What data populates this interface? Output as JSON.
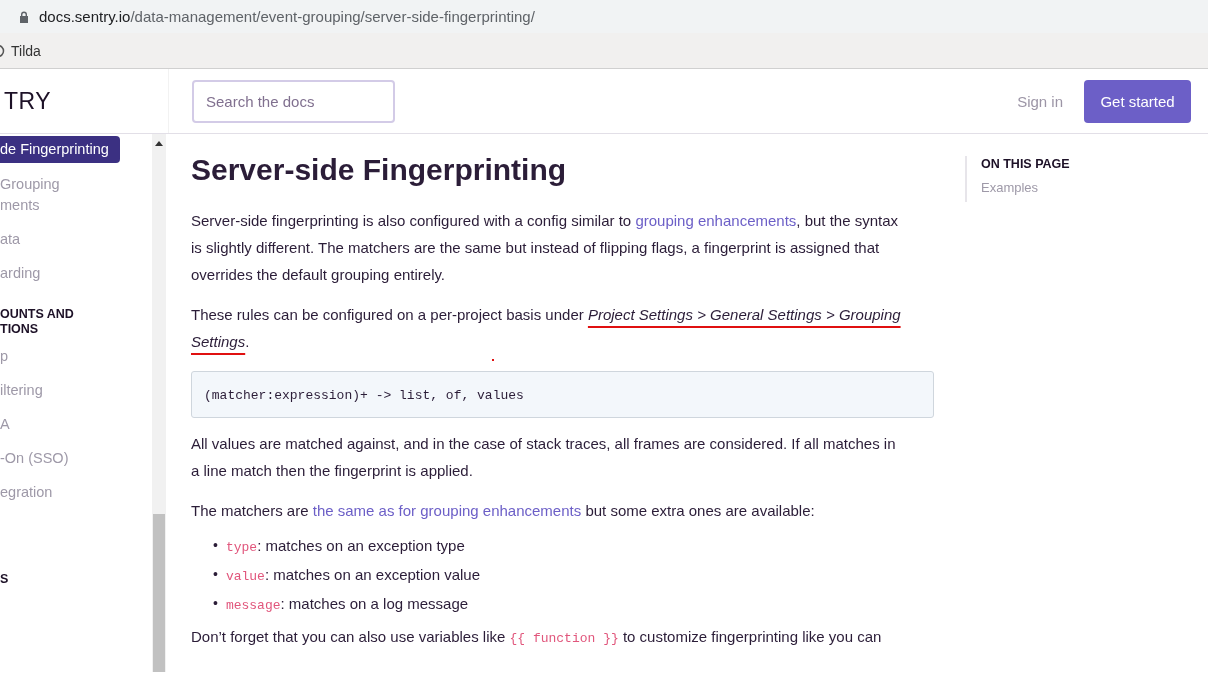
{
  "browser": {
    "url_host": "docs.sentry.io",
    "url_path": "/data-management/event-grouping/server-side-fingerprinting/",
    "bookmarks": [
      {
        "label": "Tilda"
      }
    ]
  },
  "header": {
    "logo": "TRY",
    "search": {
      "placeholder": "Search the docs"
    },
    "sign_in": "Sign in",
    "get_started": "Get started"
  },
  "sidebar": {
    "items": [
      {
        "kind": "link",
        "label": "de Fingerprinting",
        "selected": true
      },
      {
        "kind": "link",
        "label": "Grouping\nments",
        "selected": false
      },
      {
        "kind": "link",
        "label": "ata",
        "selected": false
      },
      {
        "kind": "link",
        "label": "arding",
        "selected": false
      },
      {
        "kind": "heading",
        "label": "OUNTS AND\nTIONS"
      },
      {
        "kind": "link",
        "label": "p",
        "selected": false
      },
      {
        "kind": "link",
        "label": "iltering",
        "selected": false
      },
      {
        "kind": "link",
        "label": "A",
        "selected": false
      },
      {
        "kind": "link",
        "label": "-On (SSO)",
        "selected": false
      },
      {
        "kind": "link",
        "label": "egration",
        "selected": false
      },
      {
        "kind": "heading",
        "label": "S"
      }
    ]
  },
  "article": {
    "title": "Server-side Fingerprinting",
    "blocks": [
      {
        "kind": "paragraph",
        "parts": [
          {
            "text": "Server-side fingerprinting is also configured with a config similar to "
          },
          {
            "text": "grouping enhancements",
            "link": true
          },
          {
            "text": ", but the syntax is slightly different. The matchers are the same but instead of flipping flags, a fingerprint is assigned that overrides the default grouping entirely."
          }
        ]
      },
      {
        "kind": "marked",
        "parts": [
          {
            "text": "These rules can be configured on a per-project basis under "
          },
          {
            "text": "Project Settings > General Settings > Grouping Settings",
            "italic": true
          },
          {
            "text": "."
          }
        ]
      },
      {
        "kind": "code",
        "text": "(matcher:expression)+ -> list, of, values"
      },
      {
        "kind": "paragraph",
        "parts": [
          {
            "text": "All values are matched against, and in the case of stack traces, all frames are considered. If all matches in a line match then the fingerprint is applied."
          }
        ]
      },
      {
        "kind": "paragraph",
        "parts": [
          {
            "text": "The matchers are "
          },
          {
            "text": "the same as for grouping enhancements",
            "link": true
          },
          {
            "text": " but some extra ones are available:"
          }
        ]
      },
      {
        "kind": "list",
        "items": [
          {
            "marker": "•",
            "code": "type",
            "text": ": matches on an exception type"
          },
          {
            "marker": "•",
            "code": "value",
            "text": ": matches on an exception value"
          },
          {
            "marker": "•",
            "code": "message",
            "text": ": matches on a log message"
          }
        ]
      },
      {
        "kind": "paragraph",
        "parts": [
          {
            "text": "Don’t forget that you can also use variables like "
          },
          {
            "text": "{{ function }}",
            "code": true
          },
          {
            "text": " to customize fingerprinting like you can"
          }
        ]
      }
    ]
  },
  "toc": {
    "heading": "ON THIS PAGE",
    "items": [
      {
        "label": "Examples"
      }
    ]
  }
}
